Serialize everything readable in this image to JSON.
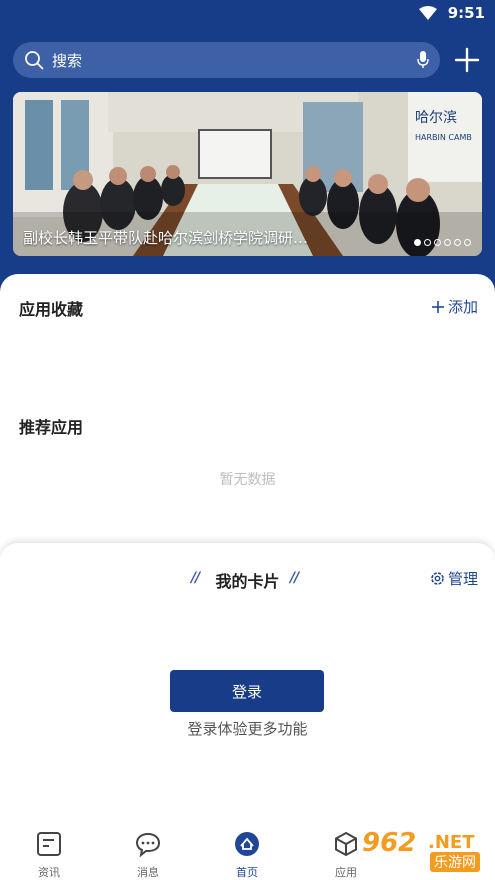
{
  "status_bar": {
    "time": "9:51"
  },
  "search": {
    "placeholder": "搜索"
  },
  "banner": {
    "caption": "副校长韩玉平带队赴哈尔滨剑桥学院调研…",
    "slide_count": 6,
    "active_slide": 1
  },
  "favorites": {
    "title": "应用收藏",
    "add_label": "添加"
  },
  "recommended": {
    "title": "推荐应用",
    "empty_text": "暂无数据"
  },
  "my_card": {
    "title": "我的卡片",
    "manage_label": "管理",
    "login_label": "登录",
    "login_hint": "登录体验更多功能"
  },
  "tabbar": {
    "items": [
      {
        "label": "资讯",
        "icon": "news-icon"
      },
      {
        "label": "消息",
        "icon": "message-icon"
      },
      {
        "label": "首页",
        "icon": "home-icon",
        "active": true
      },
      {
        "label": "应用",
        "icon": "apps-icon"
      }
    ]
  },
  "watermark": {
    "brand": "962",
    "net": ".NET",
    "sub": "乐游网"
  },
  "colors": {
    "primary": "#173c88",
    "accent": "#1f4796",
    "watermark": "#f39c1f"
  }
}
